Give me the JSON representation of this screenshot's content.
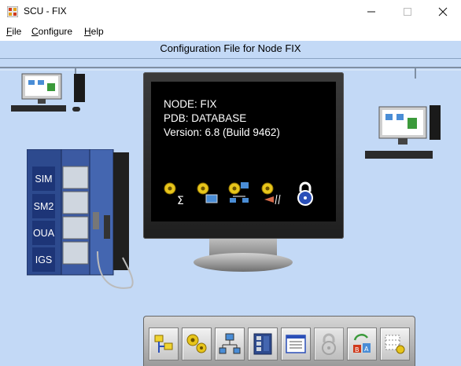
{
  "window": {
    "title": "SCU - FIX",
    "icon": "scu-app-icon",
    "controls": [
      "minimize-icon",
      "maximize-icon",
      "close-icon"
    ]
  },
  "menu": {
    "file": {
      "mnemonic": "F",
      "rest": "ile"
    },
    "configure": {
      "mnemonic": "C",
      "rest": "onfigure"
    },
    "help": {
      "mnemonic": "H",
      "rest": "elp"
    }
  },
  "header": {
    "title": "Configuration File for Node FIX"
  },
  "node_info": {
    "node": "NODE: FIX",
    "pdb": "PDB: DATABASE",
    "version": "Version:  6.8 (Build 9462)"
  },
  "rack": {
    "slots": [
      "SIM",
      "SM2",
      "OUA",
      "IGS"
    ]
  },
  "screen_icons": [
    "sigma-alarm-icon",
    "display-alarm-icon",
    "network-alarm-icon",
    "connection-alarm-icon",
    "security-lock-icon"
  ],
  "toolbar": {
    "buttons": [
      "startup-tasks-icon",
      "alarm-configuration-icon",
      "network-configuration-icon",
      "scada-configuration-icon",
      "local-startup-icon",
      "security-icon",
      "sql-configuration-icon",
      "alarm-areas-icon"
    ]
  },
  "colors": {
    "canvas_background": "#c3d9f6",
    "rack_slot": "#1d3577",
    "screen": "#000000"
  }
}
